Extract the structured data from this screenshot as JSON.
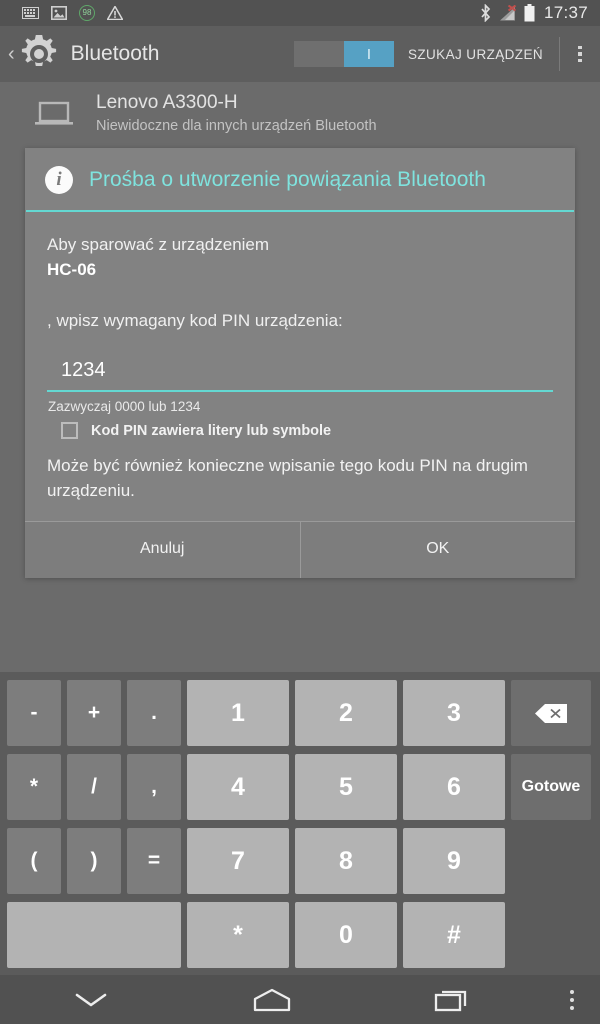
{
  "status_bar": {
    "icons": [
      "keyboard-icon",
      "screenshot-icon",
      "battery-percent-badge",
      "warning-icon"
    ],
    "battery_badge": "98",
    "right_icons": [
      "bluetooth-icon",
      "signal-no-service-icon",
      "battery-icon"
    ],
    "time": "17:37"
  },
  "action_bar": {
    "up_label": "‹",
    "title": "Bluetooth",
    "switch_on": true,
    "switch_thumb_label": "I",
    "search_label": "SZUKAJ URZĄDZEŃ",
    "accent_color": "#56a1c4"
  },
  "local_device": {
    "name": "Lenovo A3300-H",
    "subtitle": "Niewidoczne dla innych urządzeń Bluetooth"
  },
  "dialog": {
    "title": "Prośba o utworzenie powiązania Bluetooth",
    "accent_color": "#64d8d2",
    "line1": "Aby sparować z urządzeniem",
    "device": "HC-06",
    "line2": ", wpisz wymagany kod PIN urządzenia:",
    "pin_value": "1234",
    "pin_placeholder": "",
    "pin_hint": "Zazwyczaj 0000 lub 1234",
    "checkbox_label": "Kod PIN zawiera litery lub symbole",
    "checkbox_checked": false,
    "note": "Może być również konieczne wpisanie tego kodu PIN na drugim urządzeniu.",
    "cancel_label": "Anuluj",
    "ok_label": "OK"
  },
  "keyboard": {
    "rows": [
      {
        "symbols": [
          "-",
          "+",
          "."
        ],
        "numbers": [
          "1",
          "2",
          "3"
        ],
        "side": "backspace-icon",
        "side_type": "icon"
      },
      {
        "symbols": [
          "*",
          "/",
          ","
        ],
        "numbers": [
          "4",
          "5",
          "6"
        ],
        "side": "Gotowe",
        "side_type": "text"
      },
      {
        "symbols": [
          "(",
          ")",
          "="
        ],
        "numbers": [
          "7",
          "8",
          "9"
        ],
        "side": "",
        "side_type": "blank"
      },
      {
        "symbols": [],
        "numbers": [
          "*",
          "0",
          "#"
        ],
        "space": "",
        "side": "",
        "side_type": "blank"
      }
    ]
  },
  "nav_bar": {
    "items": [
      "hide-keyboard-icon",
      "home-icon",
      "recents-icon",
      "overflow-icon"
    ]
  }
}
